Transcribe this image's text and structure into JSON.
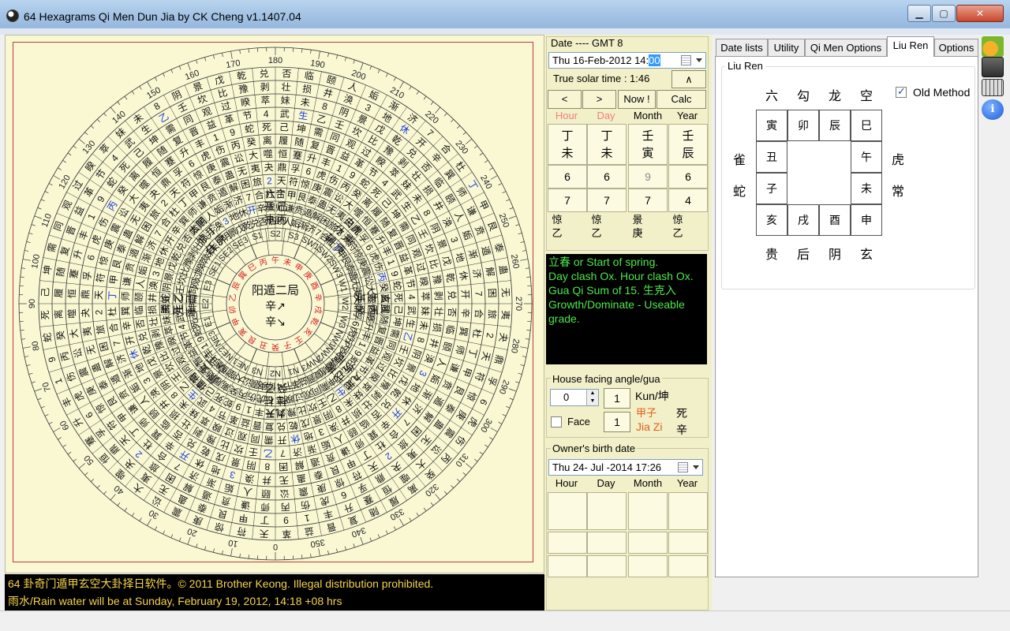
{
  "window": {
    "title": "64 Hexagrams Qi Men Dun Jia by CK Cheng v1.1407.04",
    "min_glyph": "▁",
    "max_glyph": "▢",
    "close_glyph": "✕"
  },
  "wheel": {
    "degree_labels": [
      "0",
      "10",
      "20",
      "30",
      "40",
      "50",
      "60",
      "70",
      "80",
      "90",
      "100",
      "110",
      "120",
      "130",
      "140",
      "150",
      "160",
      "170",
      "180",
      "190",
      "200",
      "210",
      "220",
      "230",
      "240",
      "250",
      "260",
      "270",
      "280",
      "290",
      "300",
      "310",
      "320",
      "330",
      "340",
      "350"
    ],
    "sector_labels": [
      "S1",
      "S2",
      "S3",
      "SW1",
      "SW2",
      "SW3",
      "W1",
      "W2",
      "W3",
      "NW1",
      "NW2",
      "NW3",
      "N1",
      "N2",
      "N3",
      "NE1",
      "NE2",
      "NE3",
      "E1",
      "E2",
      "E3",
      "SE1",
      "SE2",
      "SE3"
    ],
    "center": {
      "line1": "阳遁二局",
      "line2": "辛↗",
      "line3": "辛↘"
    },
    "inner_branch_ring": [
      "午",
      "未",
      "申",
      "庚",
      "酉",
      "辛",
      "戌",
      "乾",
      "亥",
      "壬",
      "子",
      "癸",
      "丑",
      "艮",
      "寅",
      "甲",
      "卯",
      "乙",
      "辰",
      "巽",
      "巳",
      "丙"
    ],
    "palace_texts": [
      {
        "l1": "六合",
        "l2": "开 己",
        "l3": "冲 丙"
      },
      {
        "l1": "白虎",
        "l2": "休 庚",
        "l3": "辅 庚"
      },
      {
        "l1": "玄武",
        "l2": "生 丙",
        "l3": "英 癸"
      },
      {
        "l1": "九地",
        "l2": "伤 戊",
        "l3": "丙 芮"
      },
      {
        "l1": "九天",
        "l2": "杜 柱",
        "l3": "癸 乙"
      },
      {
        "l1": "值符",
        "l2": "景 壬*",
        "l3": "心 丁*"
      },
      {
        "l1": "腾蛇",
        "l2": "死 乙",
        "l3": "蓬 己*"
      },
      {
        "l1": "太阴",
        "l2": "惊 丁",
        "l3": "任 庚"
      }
    ],
    "ring_chars": [
      "天",
      "地",
      "武",
      "虎",
      "合",
      "阴",
      "蛇",
      "符",
      "休",
      "生",
      "伤",
      "杜",
      "景",
      "死",
      "惊",
      "开",
      "乙",
      "丙",
      "丁",
      "戊",
      "己",
      "庚",
      "辛",
      "壬",
      "癸",
      "甲",
      "乾",
      "坤",
      "震",
      "巽",
      "坎",
      "离",
      "艮",
      "兑",
      "需",
      "讼",
      "师",
      "比",
      "履",
      "泰",
      "否",
      "同",
      "大",
      "谦",
      "豫",
      "随",
      "蛊",
      "临",
      "观",
      "噬",
      "贲",
      "剥",
      "复",
      "无",
      "颐",
      "过",
      "恒",
      "遁",
      "壮",
      "晋",
      "夷",
      "人",
      "睽",
      "蹇",
      "解",
      "损",
      "益",
      "夬",
      "姤",
      "萃",
      "升",
      "困",
      "井",
      "革",
      "鼎",
      "渐",
      "妹",
      "丰",
      "旅",
      "涣",
      "节",
      "孚",
      "济",
      "未",
      "1",
      "2",
      "3",
      "4",
      "6",
      "7",
      "8",
      "9"
    ],
    "blue_chars": [
      "丁",
      "休",
      "生",
      "开",
      "乙",
      "丙",
      "2",
      "3"
    ]
  },
  "status": {
    "line1": "64 卦奇门遁甲玄空大卦择日软件。© 2011 Brother Keong.  Illegal distribution prohibited.",
    "line2": "雨水/Rain water will be at Sunday, February 19, 2012, 14:18 +08 hrs"
  },
  "date_panel": {
    "caption": "Date ---- GMT 8",
    "date_value": "Thu  16-Feb-2012 14:",
    "date_selected": "00",
    "true_solar_label": "True solar time : 1:46",
    "up_btn": "∧",
    "prev_btn": "<",
    "next_btn": ">",
    "now_btn": "Now !",
    "calc_btn": "Calc",
    "headers": [
      "Hour",
      "Day",
      "Month",
      "Year"
    ],
    "header_colors": [
      "#f08080",
      "#f08080",
      "#000000",
      "#000000"
    ],
    "pillars": [
      {
        "stem": "丁",
        "branch": "未"
      },
      {
        "stem": "丁",
        "branch": "未"
      },
      {
        "stem": "壬",
        "branch": "寅"
      },
      {
        "stem": "壬",
        "branch": "辰"
      }
    ],
    "row1": [
      "6",
      "6",
      "9",
      "6"
    ],
    "row2": [
      "7",
      "7",
      "7",
      "4"
    ],
    "row1_colors": [
      "#000000",
      "#000000",
      "#8a8a8a",
      "#000000"
    ],
    "small_top": [
      "惊",
      "惊",
      "景",
      "惊"
    ],
    "small_bottom": [
      "乙",
      "乙",
      "庚",
      "乙"
    ]
  },
  "info_box": {
    "line1": "立春 or Start of spring.",
    "line2": "Day clash Ox. Hour clash Ox.",
    "line3": "Gua Qi Sum of 15. 生克入",
    "line4": "Growth/Dominate - Useable",
    "line5": "grade."
  },
  "house": {
    "caption": "House facing angle/gua",
    "angle_value": "0",
    "box1": "1",
    "box2": "1",
    "face_label": "Face",
    "gua": "Kun/坤",
    "jiazi_cn": "甲子",
    "jiazi_en": "Jia Zi",
    "right_top": "死",
    "right_bottom": "辛"
  },
  "owner": {
    "caption": "Owner's birth date",
    "date_value": "Thu  24- Jul -2014   17:26",
    "headers": [
      "Hour",
      "Day",
      "Month",
      "Year"
    ]
  },
  "tabs": [
    "Date lists",
    "Utility",
    "Qi Men Options",
    "Liu Ren",
    "Options"
  ],
  "liu_ren": {
    "group_label": "Liu Ren",
    "old_method_label": "Old Method",
    "top": [
      "六",
      "勾",
      "龙",
      "空"
    ],
    "left": [
      "雀",
      "蛇"
    ],
    "right": [
      "虎",
      "常"
    ],
    "bottom": [
      "贵",
      "后",
      "阴",
      "玄"
    ],
    "grid_top": [
      "寅",
      "卯",
      "辰",
      "巳"
    ],
    "grid_left": [
      "丑",
      "子"
    ],
    "grid_right": [
      "午",
      "未"
    ],
    "grid_bottom": [
      "亥",
      "戌",
      "酉",
      "申"
    ]
  },
  "colors": {
    "wheel_bg": "#f9f8d3",
    "ring_red": "#d62020",
    "blue_text": "#1a3adb",
    "status_text": "#f6d44a",
    "info_text": "#4de84d",
    "orange_text": "#e0601c"
  }
}
